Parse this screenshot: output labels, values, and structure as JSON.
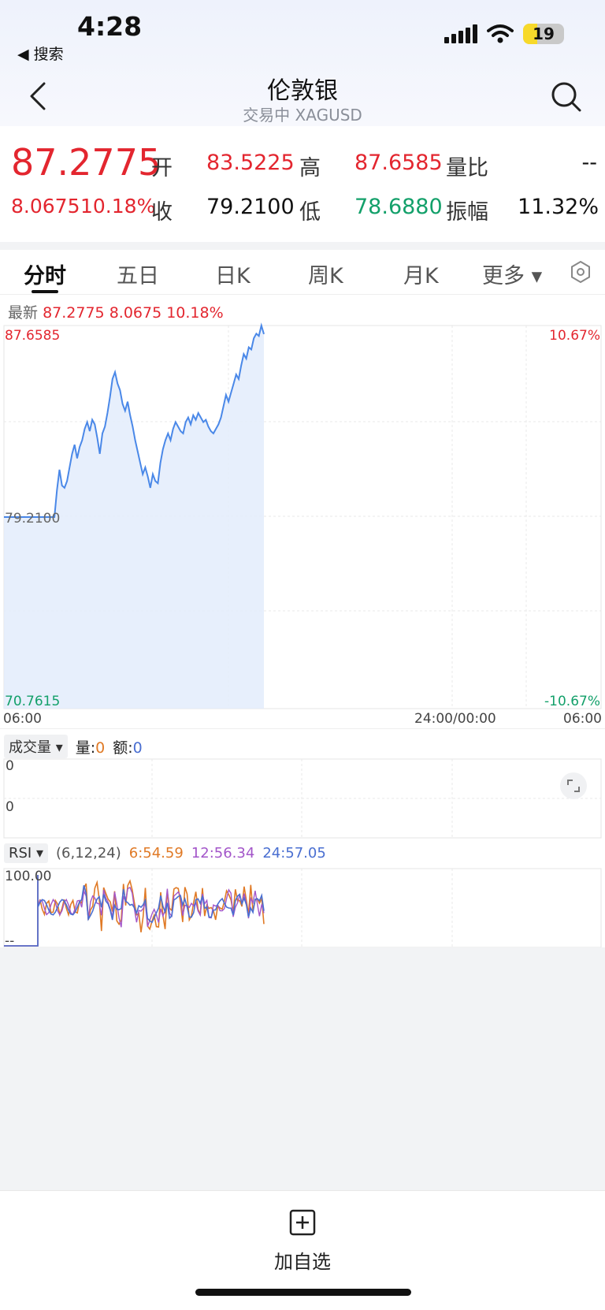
{
  "status": {
    "time": "4:28",
    "back_app": "◀ 搜索",
    "battery": "19"
  },
  "header": {
    "title": "伦敦银",
    "subtitle": "交易中 XAGUSD"
  },
  "quote": {
    "price": "87.2775",
    "change": "8.0675",
    "change_pct": "10.18%",
    "open_label": "开",
    "open": "83.5225",
    "close_label": "收",
    "close": "79.2100",
    "high_label": "高",
    "high": "87.6585",
    "low_label": "低",
    "low": "78.6880",
    "volratio_label": "量比",
    "volratio": "--",
    "amplitude_label": "振幅",
    "amplitude": "11.32%"
  },
  "tabs": [
    "分时",
    "五日",
    "日K",
    "周K",
    "月K",
    "更多 ▾"
  ],
  "latest": {
    "label": "最新",
    "price": "87.2775",
    "change": "8.0675",
    "pct": "10.18%"
  },
  "chart_data": {
    "type": "line",
    "y_top": "87.6585",
    "y_mid": "79.2100",
    "y_bottom": "70.7615",
    "pct_top": "10.67%",
    "pct_bottom": "-10.67%",
    "x_start": "06:00",
    "x_mid": "24:00/00:00",
    "x_end": "06:00",
    "ylim": [
      70.7615,
      87.6585
    ],
    "values": [
      79.21,
      79.21,
      79.21,
      79.21,
      79.21,
      79.21,
      79.21,
      79.21,
      79.21,
      79.21,
      79.21,
      79.21,
      79.21,
      79.21,
      79.21,
      79.21,
      79.21,
      79.21,
      79.21,
      79.21,
      79.21,
      80.4,
      81.3,
      80.6,
      80.5,
      80.8,
      81.4,
      82.0,
      82.4,
      81.8,
      82.3,
      82.6,
      83.1,
      83.4,
      83.0,
      83.5,
      83.3,
      82.7,
      82.0,
      82.9,
      83.2,
      83.8,
      84.5,
      85.3,
      85.6,
      85.1,
      84.8,
      84.2,
      83.9,
      84.3,
      83.7,
      83.2,
      82.6,
      82.1,
      81.6,
      81.1,
      81.4,
      81.0,
      80.5,
      81.1,
      80.8,
      80.7,
      81.6,
      82.2,
      82.6,
      82.9,
      82.6,
      83.1,
      83.4,
      83.2,
      83.0,
      82.9,
      83.4,
      83.6,
      83.3,
      83.7,
      83.5,
      83.8,
      83.6,
      83.4,
      83.5,
      83.2,
      83.0,
      82.9,
      83.1,
      83.3,
      83.6,
      84.1,
      84.6,
      84.3,
      84.7,
      85.1,
      85.5,
      85.3,
      85.9,
      86.4,
      86.2,
      86.7,
      86.6,
      87.1,
      87.3,
      87.2,
      87.66,
      87.28
    ],
    "rsi_label": "RSI",
    "rsi_params": "(6,12,24)",
    "rsi6": "6:54.59",
    "rsi12": "12:56.34",
    "rsi24": "24:57.05",
    "rsi_top": "100.00",
    "rsi_bottom": "--"
  },
  "volume": {
    "label": "成交量",
    "qty_label": "量:",
    "qty": "0",
    "amt_label": "额:",
    "amt": "0",
    "y1": "0",
    "y2": "0"
  },
  "bottom": {
    "add_label": "加自选"
  },
  "colors": {
    "up": "#e3262f",
    "down": "#13a06a",
    "line": "#4a88e8",
    "rsi6": "#e07a26",
    "rsi12": "#a356c9",
    "rsi24": "#4a6fd1"
  }
}
